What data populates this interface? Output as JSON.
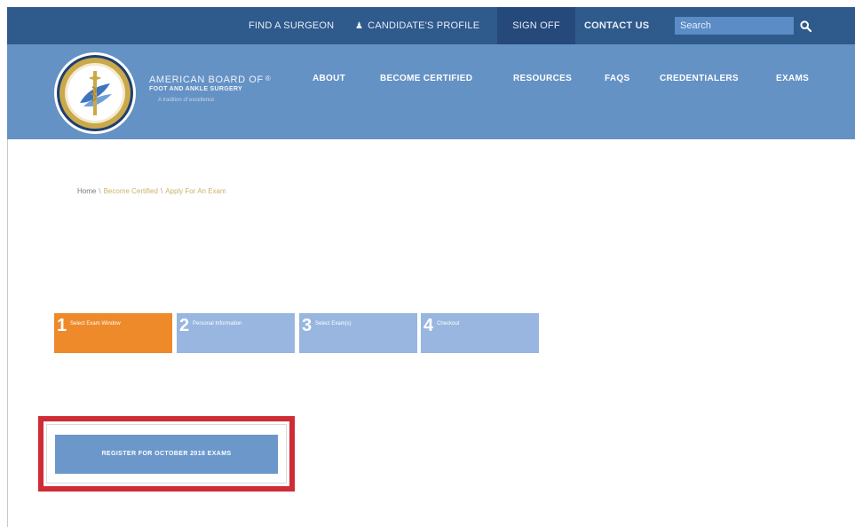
{
  "top_nav": {
    "find_surgeon": "FIND A SURGEON",
    "candidates_profile": "CANDIDATE'S PROFILE",
    "sign_off": "SIGN OFF",
    "contact_us": "CONTACT US",
    "search_placeholder": "Search"
  },
  "brand": {
    "line1": "AMERICAN BOARD OF",
    "registered": "®",
    "line2": "FOOT AND ANKLE SURGERY",
    "tagline": "A tradition of excellence"
  },
  "main_nav": {
    "about": "ABOUT",
    "become_certified": "BECOME CERTIFIED",
    "resources": "RESOURCES",
    "faqs": "FAQS",
    "credentialers": "CREDENTIALERS",
    "exams": "EXAMS"
  },
  "breadcrumb": {
    "home": "Home",
    "sep": "\\",
    "become_certified": "Become Certified",
    "apply": "Apply For An Exam"
  },
  "steps": [
    {
      "number": "1",
      "label": "Select Exam Window",
      "active": true
    },
    {
      "number": "2",
      "label": "Personal Information",
      "active": false
    },
    {
      "number": "3",
      "label": "Select Exam(s)",
      "active": false
    },
    {
      "number": "4",
      "label": "Checkout",
      "active": false
    }
  ],
  "register_button": "REGISTER FOR OCTOBER 2018 EXAMS",
  "colors": {
    "top_bar": "#2e5a8c",
    "main_bar": "#6592c5",
    "step_active": "#ee8a2a",
    "step_inactive": "#98b6df",
    "highlight": "#cf2c36",
    "button": "#6b97cb"
  },
  "icons": {
    "person": "person-icon",
    "search": "search-icon",
    "seal": "seal-logo"
  }
}
